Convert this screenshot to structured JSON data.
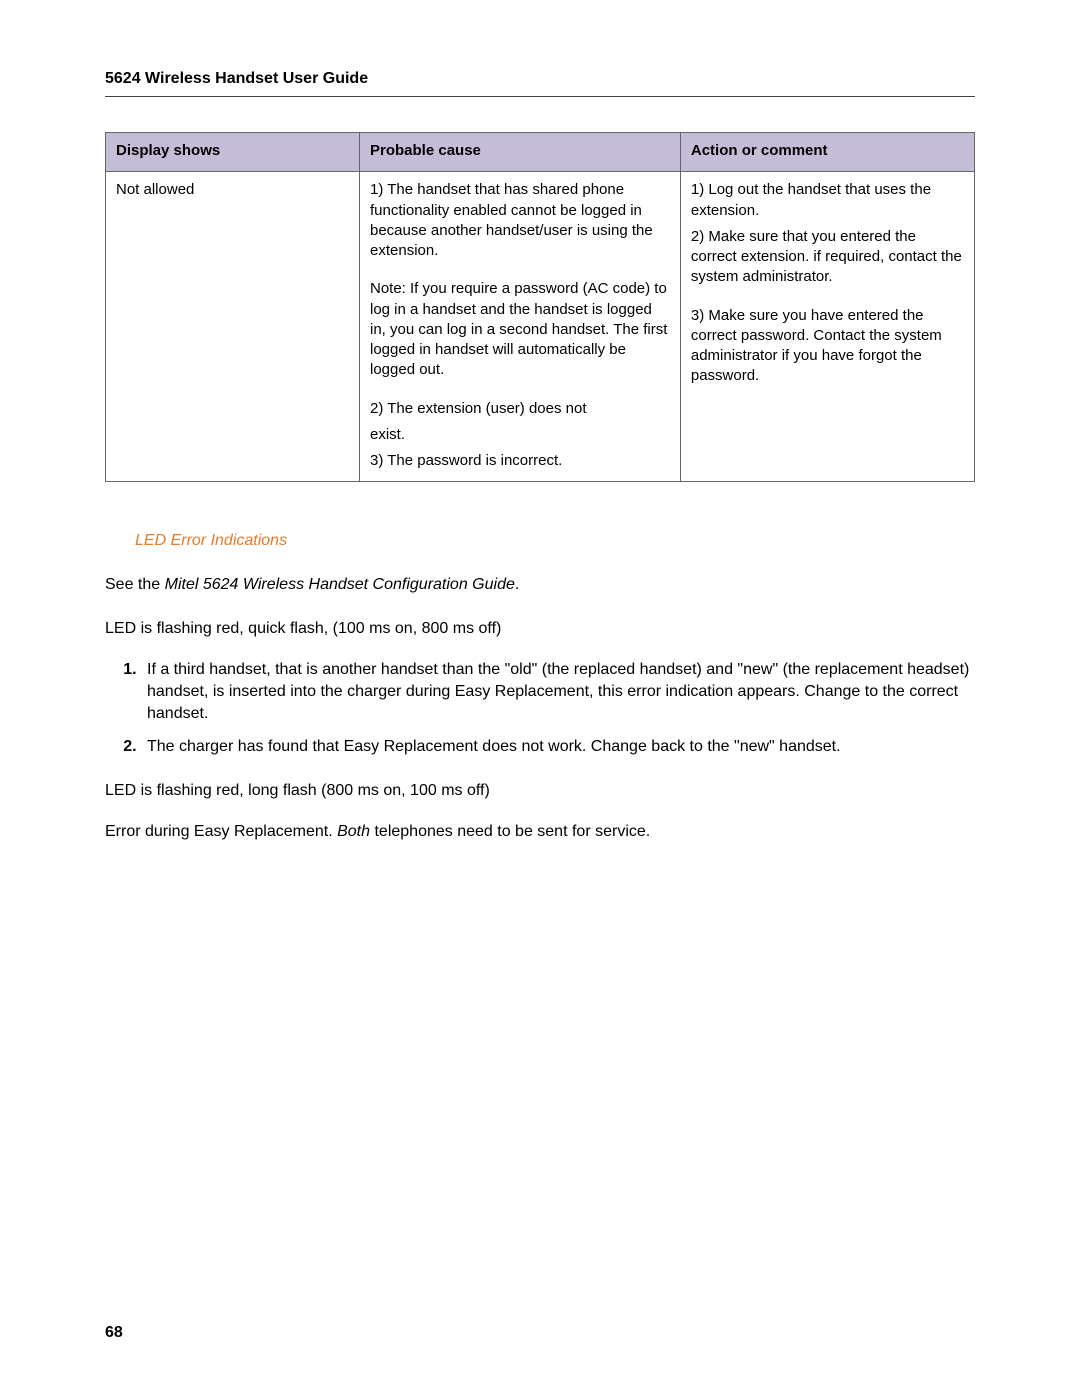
{
  "header_title": "5624 Wireless Handset User Guide",
  "table": {
    "headers": {
      "col1": "Display shows",
      "col2": "Probable cause",
      "col3": "Action or comment"
    },
    "row": {
      "display": "Not allowed",
      "cause_p1": "1) The handset that has shared phone functionality enabled cannot be logged in because another handset/user is using the extension.",
      "cause_note": "Note: If you require a password (AC code) to log in a handset and the handset is logged in, you can log in a second handset. The first logged in handset will automatically be logged out.",
      "cause_p2a": "2) The extension (user) does not",
      "cause_p2b": "exist.",
      "cause_p3": "3) The password is incorrect.",
      "action_p1": "1) Log out the handset that uses the extension.",
      "action_p2": "2) Make sure that you entered the correct extension. if required, contact the system administrator.",
      "action_p3": "3) Make sure you have entered the correct password. Contact the system administrator if you have forgot the password."
    }
  },
  "section_title": "LED Error Indications",
  "see_prefix": "See the ",
  "see_italic": "Mitel 5624 Wireless Handset Configuration Guide",
  "see_suffix": ".",
  "led_quick": "LED is flashing red, quick flash, (100 ms on, 800 ms off)",
  "list": {
    "item1": "If a third handset, that is another handset than the \"old\" (the replaced handset) and \"new\" (the replacement headset) handset, is inserted into the charger during Easy Replacement, this error indication appears. Change to the correct handset.",
    "item2": "The charger has found that Easy Replacement does not work. Change back to the \"new\" handset."
  },
  "led_long": "LED is flashing red, long flash (800 ms on, 100 ms off)",
  "error_prefix": "Error during Easy Replacement. ",
  "error_italic": "Both",
  "error_suffix": " telephones need to be sent for service.",
  "page_number": "68"
}
